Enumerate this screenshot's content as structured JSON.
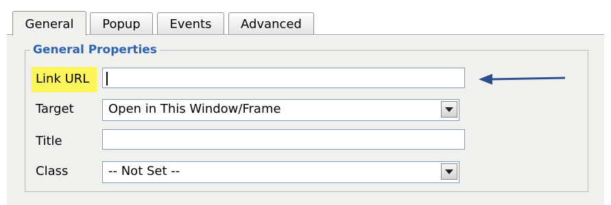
{
  "tabs": [
    {
      "label": "General",
      "active": true
    },
    {
      "label": "Popup",
      "active": false
    },
    {
      "label": "Events",
      "active": false
    },
    {
      "label": "Advanced",
      "active": false
    }
  ],
  "group": {
    "legend": "General Properties"
  },
  "fields": {
    "link_url": {
      "label": "Link URL",
      "value": ""
    },
    "target": {
      "label": "Target",
      "value": "Open in This Window/Frame"
    },
    "title": {
      "label": "Title",
      "value": ""
    },
    "class": {
      "label": "Class",
      "value": "-- Not Set --"
    }
  },
  "colors": {
    "legend": "#2b63b5",
    "highlight": "#fdf55a",
    "arrow": "#2b4f8c",
    "panel": "#f0f0ee"
  },
  "annotation": {
    "icon": "left-arrow-icon"
  }
}
